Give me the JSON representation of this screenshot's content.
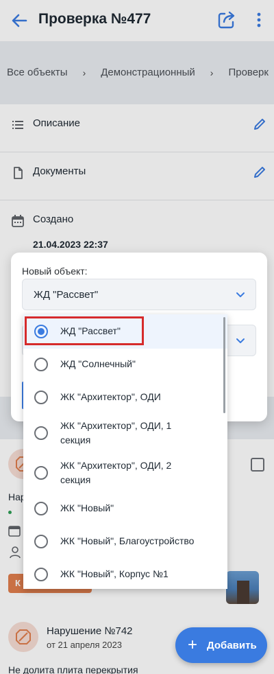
{
  "appbar": {
    "title": "Проверка №477"
  },
  "breadcrumbs": [
    "Все объекты",
    "Демонстрационный",
    "Проверк"
  ],
  "info": {
    "description_label": "Описание",
    "documents_label": "Документы",
    "created_label": "Создано",
    "created_value": "21.04.2023 22:37"
  },
  "dialog": {
    "new_object_label": "Новый объект:",
    "selected_value": "ЖД \"Рассвет\""
  },
  "dropdown": {
    "options": [
      "ЖД \"Рассвет\"",
      "ЖД \"Солнечный\"",
      "ЖК \"Архитектор\", ОДИ",
      "ЖК \"Архитектор\", ОДИ, 1 секция",
      "ЖК \"Архитектор\", ОДИ, 2 секция",
      "ЖК \"Новый\"",
      "ЖК \"Новый\", Благоустройство",
      "ЖК \"Новый\", Корпус №1"
    ],
    "selected_index": 0
  },
  "violations": [
    {
      "text_partial": "Нар",
      "chip_partial": "К"
    },
    {
      "title": "Нарушение №742",
      "subtitle": "от 21 апреля 2023",
      "description_partial": "Не долита плита перекрытия"
    }
  ],
  "fab": {
    "plus": "+",
    "label": "Добавить"
  },
  "colors": {
    "accent": "#3a7be0",
    "chip": "#e07e4d",
    "highlight": "#d62b2b"
  }
}
